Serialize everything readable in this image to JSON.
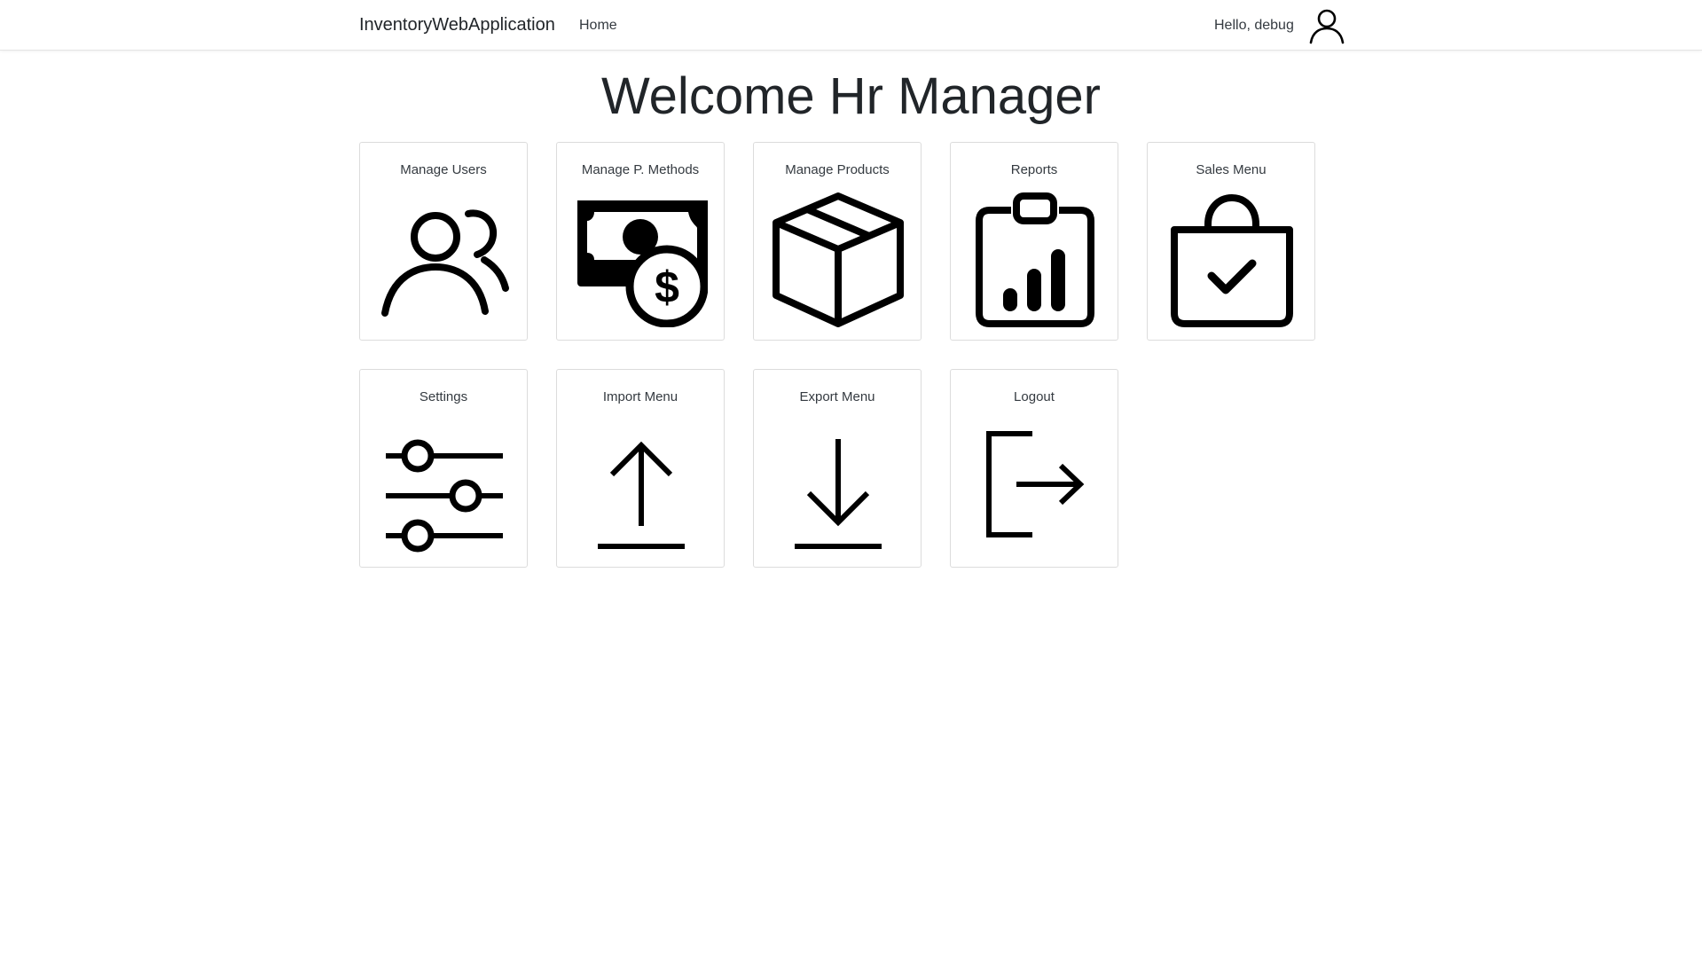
{
  "navbar": {
    "brand": "InventoryWebApplication",
    "home_link": "Home",
    "greeting": "Hello, debug",
    "avatar_icon": "user-icon"
  },
  "main": {
    "title": "Welcome Hr Manager",
    "tiles": [
      {
        "label": "Manage Users",
        "icon": "users-icon"
      },
      {
        "label": "Manage P. Methods",
        "icon": "cash-dollar-icon"
      },
      {
        "label": "Manage Products",
        "icon": "box-icon"
      },
      {
        "label": "Reports",
        "icon": "clipboard-chart-icon"
      },
      {
        "label": "Sales Menu",
        "icon": "shopping-bag-check-icon"
      },
      {
        "label": "Settings",
        "icon": "sliders-icon"
      },
      {
        "label": "Import Menu",
        "icon": "upload-arrow-icon"
      },
      {
        "label": "Export Menu",
        "icon": "download-arrow-icon"
      },
      {
        "label": "Logout",
        "icon": "logout-icon"
      }
    ]
  }
}
